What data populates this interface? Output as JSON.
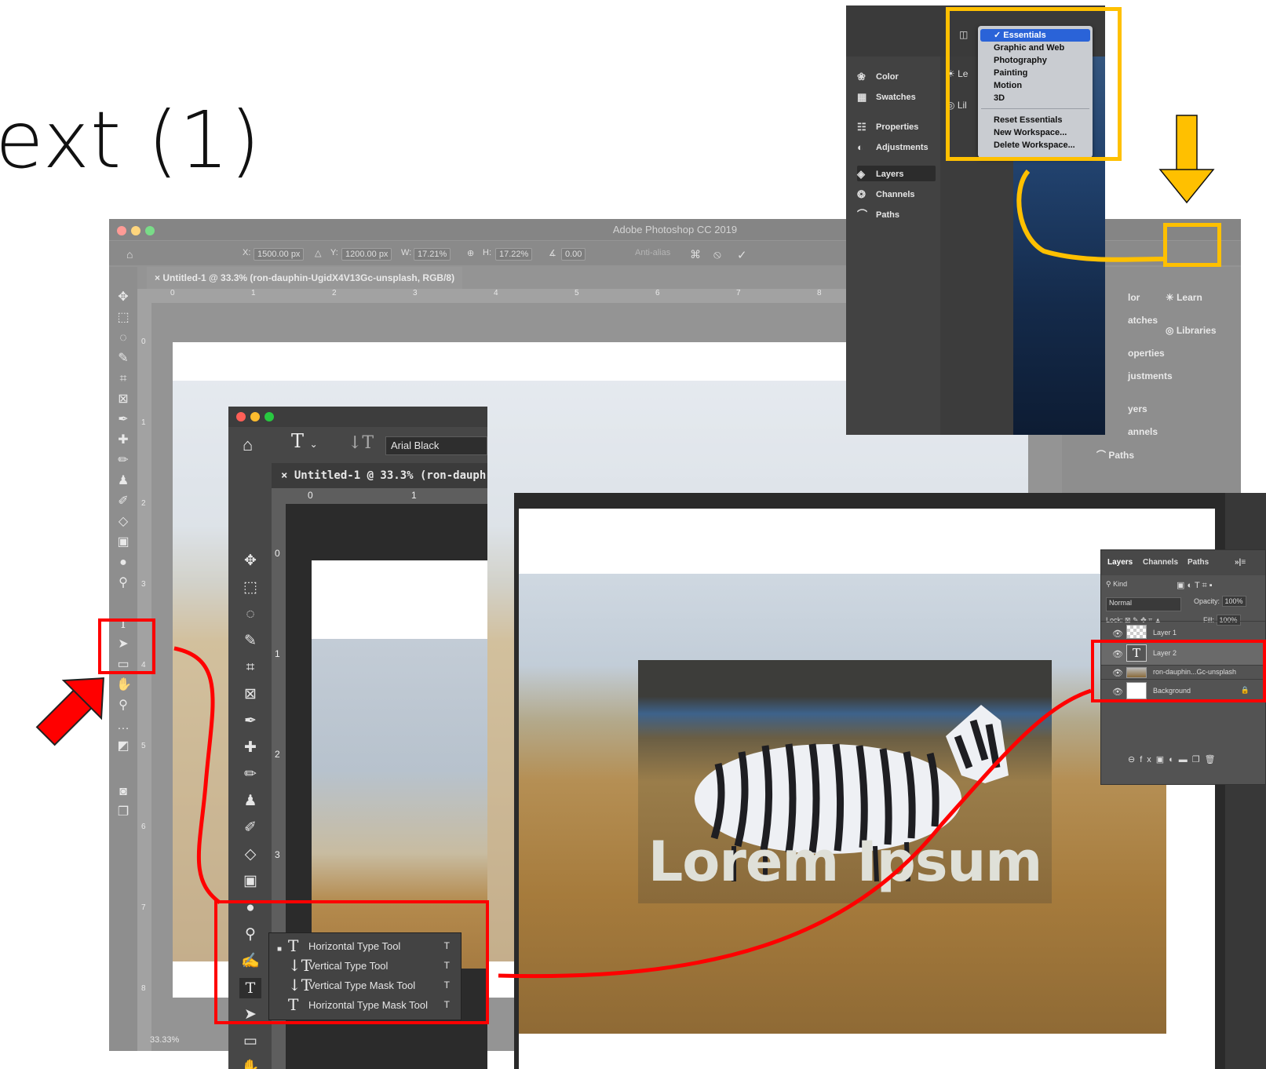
{
  "slide": {
    "title": "ext (1)"
  },
  "background_window": {
    "app_title": "Adobe Photoshop CC 2019",
    "options": {
      "x_label": "X:",
      "x_value": "1500.00 px",
      "y_label": "Y:",
      "y_value": "1200.00 px",
      "w_label": "W:",
      "w_value": "17.21%",
      "h_label": "H:",
      "h_value": "17.22%",
      "angle_value": "0.00",
      "antialias": "Anti-alias"
    },
    "doc_tab": "Untitled-1 @ 33.3% (ron-dauphin-UgidX4V13Gc-unsplash, RGB/8)",
    "zoom": "33.33%",
    "ruler_ticks": [
      "0",
      "1",
      "2",
      "3",
      "4",
      "5",
      "6",
      "7",
      "8"
    ],
    "v_ruler_ticks": [
      "0",
      "1",
      "2",
      "3",
      "4",
      "5",
      "6",
      "7",
      "8"
    ],
    "panels": {
      "learn": "Learn",
      "libraries": "Libraries",
      "color_partial": "lor",
      "swatches_partial": "atches",
      "properties_partial": "operties",
      "adjustments_partial": "justments",
      "layers_partial": "yers",
      "channels_partial": "annels",
      "paths": "Paths"
    }
  },
  "workspace_window": {
    "panel_items": [
      "Color",
      "Swatches",
      "Properties",
      "Adjustments",
      "Layers",
      "Channels",
      "Paths"
    ],
    "col2_partials": [
      "Le",
      "Lil"
    ],
    "menu": {
      "selected_check": "✓",
      "items": [
        "Essentials",
        "Graphic and Web",
        "Photography",
        "Painting",
        "Motion",
        "3D"
      ],
      "actions": [
        "Reset Essentials",
        "New Workspace...",
        "Delete Workspace..."
      ]
    }
  },
  "type_tool_window": {
    "font": "Arial Black",
    "doc_tab": "Untitled-1 @ 33.3% (ron-dauph",
    "ruler_ticks": [
      "0",
      "1"
    ],
    "v_ruler_ticks": [
      "0",
      "1",
      "2",
      "3"
    ],
    "flyout": [
      {
        "label": "Horizontal Type Tool",
        "shortcut": "T",
        "glyph": "T"
      },
      {
        "label": "Vertical Type Tool",
        "shortcut": "T",
        "glyph": "↓T"
      },
      {
        "label": "Vertical Type Mask Tool",
        "shortcut": "T",
        "glyph": "↓T"
      },
      {
        "label": "Horizontal Type Mask Tool",
        "shortcut": "T",
        "glyph": "T"
      }
    ]
  },
  "result_window": {
    "text_overlay": "Lorem Ipsum",
    "layers_panel": {
      "tabs": [
        "Layers",
        "Channels",
        "Paths"
      ],
      "kind_placeholder": "Kind",
      "blend_mode": "Normal",
      "opacity_label": "Opacity:",
      "opacity_value": "100%",
      "lock_label": "Lock:",
      "fill_label": "Fill:",
      "fill_value": "100%",
      "layers": [
        "Layer 1",
        "Layer 2",
        "ron-dauphin...Gc-unsplash",
        "Background"
      ]
    }
  },
  "colors": {
    "annotation_red": "#ff0000",
    "annotation_yellow": "#ffc000",
    "menu_highlight": "#2a63d8"
  }
}
